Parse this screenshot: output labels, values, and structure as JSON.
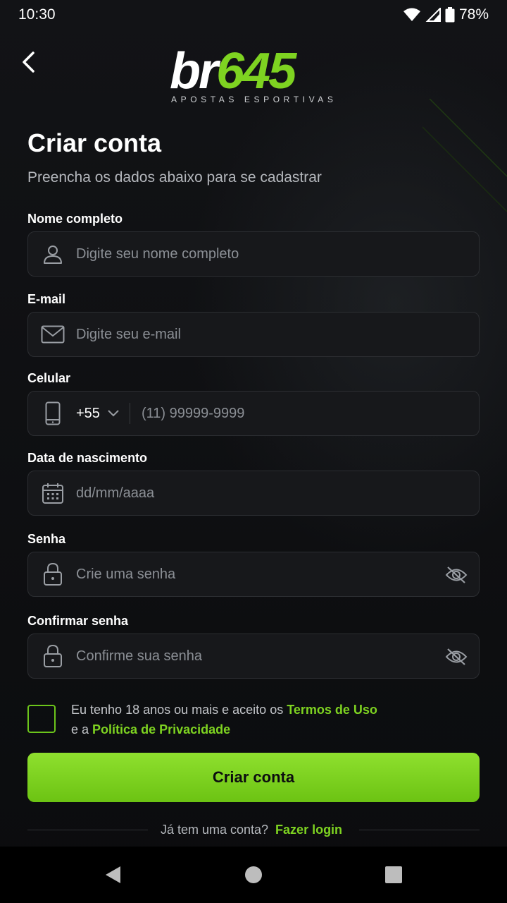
{
  "status_bar": {
    "time": "10:30",
    "battery": "78%"
  },
  "header": {
    "logo_white": "br",
    "logo_green": "645",
    "logo_tagline": "APOSTAS ESPORTIVAS"
  },
  "page": {
    "title": "Criar conta",
    "subtitle": "Preencha os dados abaixo para se cadastrar"
  },
  "form": {
    "name": {
      "label": "Nome completo",
      "placeholder": "Digite seu nome completo",
      "icon": "user-icon"
    },
    "email": {
      "label": "E-mail",
      "placeholder": "Digite seu e-mail",
      "icon": "mail-icon"
    },
    "phone": {
      "label": "Celular",
      "country_code": "+55",
      "placeholder": "(11) 99999-9999",
      "icon": "phone-icon"
    },
    "birthdate": {
      "label": "Data de nascimento",
      "placeholder": "dd/mm/aaaa",
      "icon": "calendar-icon"
    },
    "password": {
      "label": "Senha",
      "placeholder": "Crie uma senha",
      "icon": "lock-icon"
    },
    "confirm_password": {
      "label": "Confirmar senha",
      "placeholder": "Confirme sua senha",
      "icon": "lock-icon"
    },
    "terms": {
      "prefix": "Eu tenho 18 anos ou mais e aceito os",
      "terms_link": "Termos de Uso",
      "middle": "e a",
      "privacy_link": "Política de Privacidade",
      "checked": false
    },
    "submit_label": "Criar conta"
  },
  "footer": {
    "question": "Já tem uma conta?",
    "login_link": "Fazer login"
  },
  "colors": {
    "accent": "#7ed321",
    "background": "#0c0d0f",
    "input_bg": "#17181b"
  }
}
